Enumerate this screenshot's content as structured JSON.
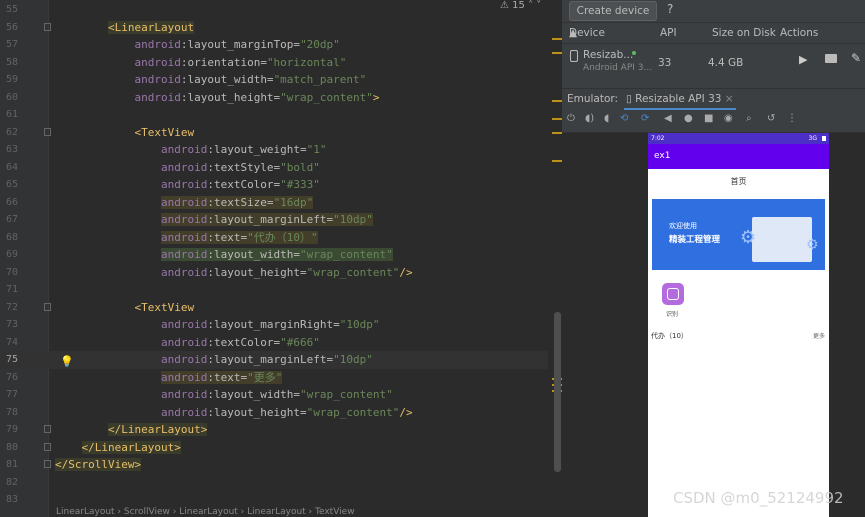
{
  "editor": {
    "problems_count": "15",
    "lines": [
      {
        "n": "55",
        "html": ""
      },
      {
        "n": "56",
        "parts": [
          [
            "tagbg",
            "<LinearLayout"
          ]
        ],
        "indent": "        "
      },
      {
        "n": "57",
        "indent": "            ",
        "attr": "android:layout_marginTop",
        "val": "\"20dp\""
      },
      {
        "n": "58",
        "indent": "            ",
        "attr": "android:orientation",
        "val": "\"horizontal\""
      },
      {
        "n": "59",
        "indent": "            ",
        "attr": "android:layout_width",
        "val": "\"match_parent\""
      },
      {
        "n": "60",
        "indent": "            ",
        "attr": "android:layout_height",
        "val": "\"wrap_content\"",
        "tail": ">"
      },
      {
        "n": "61"
      },
      {
        "n": "62",
        "indent": "            ",
        "tag": "<TextView"
      },
      {
        "n": "63",
        "indent": "                ",
        "attr": "android:layout_weight",
        "val": "\"1\""
      },
      {
        "n": "64",
        "indent": "                ",
        "attr": "android:textStyle",
        "val": "\"bold\""
      },
      {
        "n": "65",
        "indent": "                ",
        "attr": "android:textColor",
        "val": "\"#333\""
      },
      {
        "n": "66",
        "indent": "                ",
        "attr": "android:textSize",
        "val": "\"16dp\"",
        "hl": "hl2"
      },
      {
        "n": "67",
        "indent": "                ",
        "attr": "android:layout_marginLeft",
        "val": "\"10dp\"",
        "hl": "hl2"
      },
      {
        "n": "68",
        "indent": "                ",
        "attr": "android:text",
        "val": "\"代办（10）\"",
        "hl": "hl2"
      },
      {
        "n": "69",
        "indent": "                ",
        "attr": "android:layout_width",
        "val": "\"wrap_content\"",
        "hl": "hl"
      },
      {
        "n": "70",
        "indent": "                ",
        "attr": "android:layout_height",
        "val": "\"wrap_content\"",
        "tail": "/>"
      },
      {
        "n": "71"
      },
      {
        "n": "72",
        "indent": "            ",
        "tag": "<TextView"
      },
      {
        "n": "73",
        "indent": "                ",
        "attr": "android:layout_marginRight",
        "val": "\"10dp\""
      },
      {
        "n": "74",
        "indent": "                ",
        "attr": "android:textColor",
        "val": "\"#666\""
      },
      {
        "n": "75",
        "indent": "                ",
        "attr": "android:layout_marginLeft",
        "val": "\"10dp\"",
        "cur": true
      },
      {
        "n": "76",
        "indent": "                ",
        "attr": "android:text",
        "val": "\"更多\"",
        "hl": "hl2"
      },
      {
        "n": "77",
        "indent": "                ",
        "attr": "android:layout_width",
        "val": "\"wrap_content\""
      },
      {
        "n": "78",
        "indent": "                ",
        "attr": "android:layout_height",
        "val": "\"wrap_content\"",
        "tail": "/>"
      },
      {
        "n": "79",
        "indent": "        ",
        "tag": "</LinearLayout>",
        "tagbg": true
      },
      {
        "n": "80",
        "indent": "    ",
        "tag": "</LinearLayout>",
        "tagbg": true
      },
      {
        "n": "81",
        "indent": "",
        "tag": "</ScrollView>",
        "tagbg": true
      },
      {
        "n": "82"
      },
      {
        "n": "83"
      }
    ],
    "breadcrumb": "LinearLayout  ›  ScrollView  ›  LinearLayout  ›  LinearLayout  ›  TextView"
  },
  "device_manager": {
    "create_button": "Create device",
    "help": "?",
    "columns": [
      "Device",
      "API",
      "Size on Disk",
      "Actions"
    ],
    "device_name": "Resizab...",
    "device_sub": "Android API 3...",
    "api": "33",
    "size": "4.4 GB"
  },
  "emulator": {
    "label": "Emulator:",
    "tab": "Resizable API 33"
  },
  "phone": {
    "time": "7:02",
    "signal": "3G",
    "app_title": "ex1",
    "page_title": "首页",
    "banner_line1": "欢迎使用",
    "banner_line2": "精装工程管理",
    "icon_label": "识别",
    "agency": "代办（10）",
    "more": "更多"
  },
  "watermark": "CSDN @m0_52124992",
  "colors": {
    "tag": "#e8bf6a",
    "attr": "#bababa",
    "value": "#6a8759",
    "app_purple": "#6200ee"
  }
}
